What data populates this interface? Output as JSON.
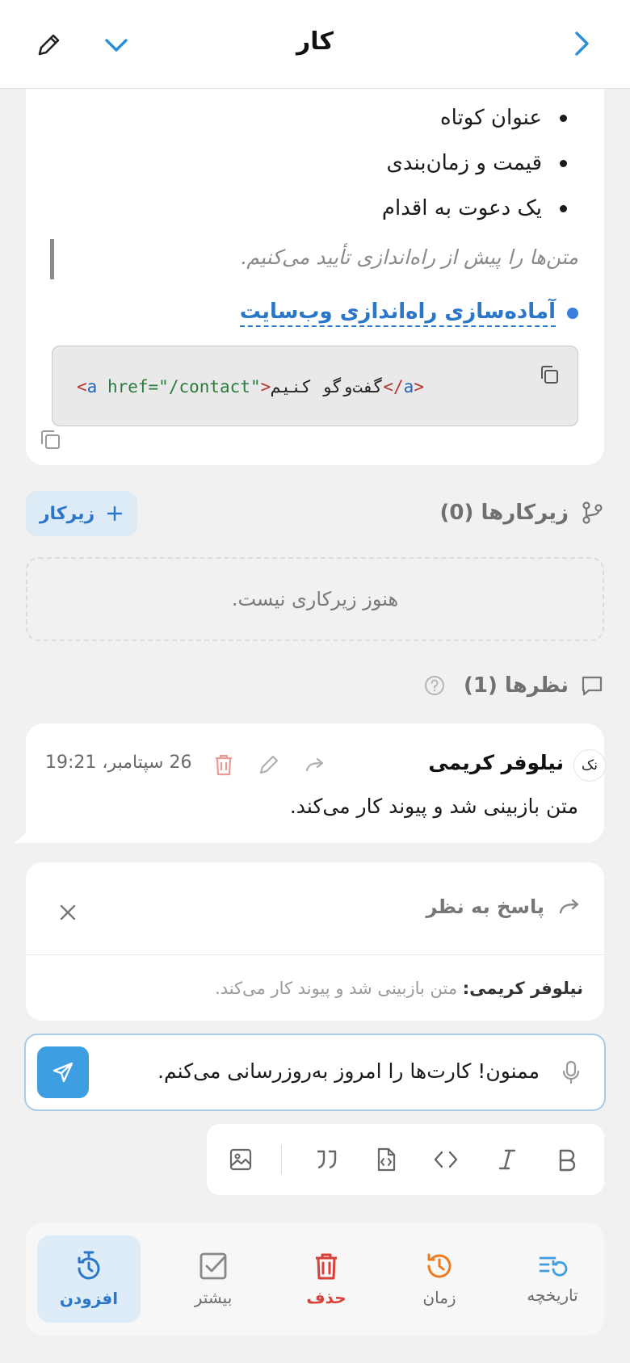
{
  "header": {
    "title": "کار"
  },
  "description": {
    "bullets": [
      "عنوان کوتاه",
      "قیمت و زمان‌بندی",
      "یک دعوت به اقدام"
    ],
    "quote": "متن‌ها را پیش از راه‌اندازی تأیید می‌کنیم.",
    "task_link": "آماده‌سازی راه‌اندازی وب‌سایت",
    "code": {
      "tag_open": "<",
      "tag": "a",
      "attr": " href=",
      "value": "\"/contact\"",
      "tag_close_open": ">",
      "text": "گفت‌وگو کنیم",
      "end_open": "</",
      "end_tag": "a",
      "end_close": ">"
    }
  },
  "subtasks": {
    "label": "زیرکارها (0)",
    "add_button": "زیرکار",
    "empty_text": "هنوز زیرکاری نیست."
  },
  "comments": {
    "label": "نظرها (1)",
    "items": [
      {
        "avatar": "نک",
        "author": "نیلوفر کریمی",
        "time": "26 سپتامبر، 19:21",
        "text": "متن بازبینی شد و پیوند کار می‌کند."
      }
    ]
  },
  "reply": {
    "title": "پاسخ به نظر",
    "quoted_author": "نیلوفر کریمی:",
    "quoted_text": "متن بازبینی شد و پیوند کار می‌کند."
  },
  "composer": {
    "value": "ممنون! کارت‌ها را امروز به‌روزرسانی می‌کنم."
  },
  "bottom_bar": {
    "history": "تاریخچه",
    "time": "زمان",
    "delete": "حذف",
    "more": "بیشتر",
    "add": "افزودن"
  },
  "colors": {
    "accent": "#3d9fe1",
    "link": "#2a77c9",
    "danger": "#d8403a",
    "orange": "#f07a1e"
  }
}
